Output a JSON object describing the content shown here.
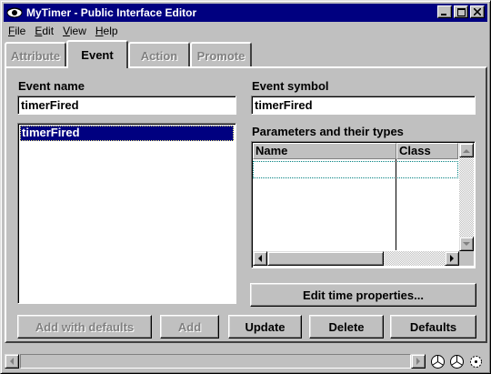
{
  "window": {
    "title": "MyTimer - Public Interface Editor",
    "icon": "eye-icon",
    "minimize_icon": "minimize-icon",
    "maximize_icon": "maximize-icon",
    "close_icon": "close-icon"
  },
  "menu": [
    {
      "underline": "F",
      "rest": "ile"
    },
    {
      "underline": "E",
      "rest": "dit"
    },
    {
      "underline": "V",
      "rest": "iew"
    },
    {
      "underline": "H",
      "rest": "elp"
    }
  ],
  "tabs": [
    {
      "label": "Attribute",
      "active": false
    },
    {
      "label": "Event",
      "active": true
    },
    {
      "label": "Action",
      "active": false
    },
    {
      "label": "Promote",
      "active": false
    }
  ],
  "form": {
    "event_name_label": "Event name",
    "event_name_value": "timerFired",
    "event_symbol_label": "Event symbol",
    "event_symbol_value": "timerFired",
    "parameters_label": "Parameters and their types",
    "events": [
      "timerFired"
    ],
    "param_columns": [
      "Name",
      "Class"
    ],
    "edit_time_button": "Edit time properties..."
  },
  "buttons": {
    "add_with_defaults": "Add with defaults",
    "add": "Add",
    "update": "Update",
    "delete": "Delete",
    "defaults": "Defaults"
  },
  "colors": {
    "face": "#c0c0c0",
    "titlebar": "#000080",
    "selection": "#000080",
    "disabled_text": "#808080"
  }
}
